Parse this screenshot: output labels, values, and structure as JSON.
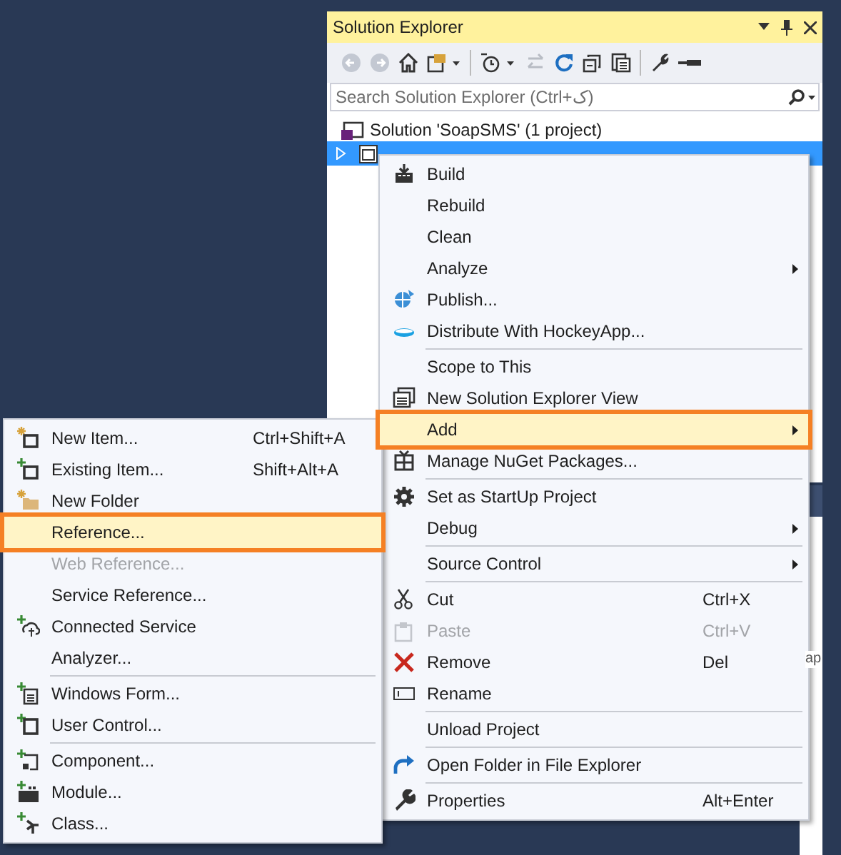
{
  "solution_explorer": {
    "title": "Solution Explorer",
    "search": {
      "placeholder": "Search Solution Explorer (Ctrl+ک)"
    },
    "tree": [
      {
        "label": "Solution 'SoapSMS' (1 project)",
        "selected": false,
        "kind": "solution"
      },
      {
        "selected": true,
        "expanded": false,
        "kind": "project"
      }
    ]
  },
  "properties_panel": {
    "fragment": "ap"
  },
  "context_menu": {
    "items": [
      {
        "label": "Build",
        "selected": false,
        "disabled": false,
        "separator_before": false,
        "submenu": false
      },
      {
        "label": "Rebuild",
        "selected": false,
        "disabled": false,
        "separator_before": false,
        "submenu": false
      },
      {
        "label": "Clean",
        "selected": false,
        "disabled": false,
        "separator_before": false,
        "submenu": false
      },
      {
        "label": "Analyze",
        "selected": false,
        "disabled": false,
        "separator_before": false,
        "submenu": true
      },
      {
        "label": "Publish...",
        "selected": false,
        "disabled": false,
        "separator_before": false,
        "submenu": false
      },
      {
        "label": "Distribute With HockeyApp...",
        "selected": false,
        "disabled": false,
        "separator_before": false,
        "submenu": false
      },
      {
        "label": "Scope to This",
        "selected": false,
        "disabled": false,
        "separator_before": true,
        "submenu": false
      },
      {
        "label": "New Solution Explorer View",
        "selected": false,
        "disabled": false,
        "separator_before": false,
        "submenu": false
      },
      {
        "label": "Add",
        "selected": true,
        "disabled": false,
        "separator_before": false,
        "submenu": true
      },
      {
        "label": "Manage NuGet Packages...",
        "selected": false,
        "disabled": false,
        "separator_before": false,
        "submenu": false
      },
      {
        "label": "Set as StartUp Project",
        "selected": false,
        "disabled": false,
        "separator_before": true,
        "submenu": false
      },
      {
        "label": "Debug",
        "selected": false,
        "disabled": false,
        "separator_before": false,
        "submenu": true
      },
      {
        "label": "Source Control",
        "selected": false,
        "disabled": false,
        "separator_before": true,
        "submenu": true
      },
      {
        "label": "Cut",
        "shortcut": "Ctrl+X",
        "selected": false,
        "disabled": false,
        "separator_before": true,
        "submenu": false
      },
      {
        "label": "Paste",
        "shortcut": "Ctrl+V",
        "selected": false,
        "disabled": true,
        "separator_before": false,
        "submenu": false
      },
      {
        "label": "Remove",
        "shortcut": "Del",
        "selected": false,
        "disabled": false,
        "separator_before": false,
        "submenu": false
      },
      {
        "label": "Rename",
        "selected": false,
        "disabled": false,
        "separator_before": false,
        "submenu": false
      },
      {
        "label": "Unload Project",
        "selected": false,
        "disabled": false,
        "separator_before": true,
        "submenu": false
      },
      {
        "label": "Open Folder in File Explorer",
        "selected": false,
        "disabled": false,
        "separator_before": true,
        "submenu": false
      },
      {
        "label": "Properties",
        "shortcut": "Alt+Enter",
        "selected": false,
        "disabled": false,
        "separator_before": true,
        "submenu": false
      }
    ]
  },
  "add_submenu": {
    "items": [
      {
        "label": "New Item...",
        "shortcut": "Ctrl+Shift+A",
        "selected": false,
        "disabled": false,
        "separator_before": false
      },
      {
        "label": "Existing Item...",
        "shortcut": "Shift+Alt+A",
        "selected": false,
        "disabled": false,
        "separator_before": false
      },
      {
        "label": "New Folder",
        "selected": false,
        "disabled": false,
        "separator_before": false
      },
      {
        "label": "Reference...",
        "selected": true,
        "disabled": false,
        "separator_before": false
      },
      {
        "label": "Web Reference...",
        "selected": false,
        "disabled": true,
        "separator_before": false
      },
      {
        "label": "Service Reference...",
        "selected": false,
        "disabled": false,
        "separator_before": false
      },
      {
        "label": "Connected Service",
        "selected": false,
        "disabled": false,
        "separator_before": false
      },
      {
        "label": "Analyzer...",
        "selected": false,
        "disabled": false,
        "separator_before": false
      },
      {
        "label": "Windows Form...",
        "selected": false,
        "disabled": false,
        "separator_before": true
      },
      {
        "label": "User Control...",
        "selected": false,
        "disabled": false,
        "separator_before": false
      },
      {
        "label": "Component...",
        "selected": false,
        "disabled": false,
        "separator_before": true
      },
      {
        "label": "Module...",
        "selected": false,
        "disabled": false,
        "separator_before": false
      },
      {
        "label": "Class...",
        "selected": false,
        "disabled": false,
        "separator_before": false
      }
    ]
  }
}
